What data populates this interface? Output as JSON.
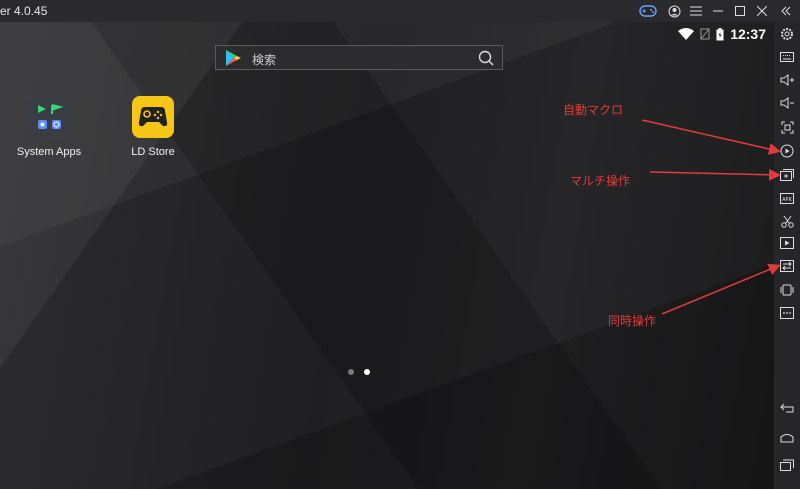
{
  "window": {
    "title": "er 4.0.45"
  },
  "status_bar": {
    "time": "12:37"
  },
  "search": {
    "placeholder": "検索"
  },
  "apps": [
    {
      "label": "System Apps"
    },
    {
      "label": "LD Store"
    }
  ],
  "annotations": {
    "macro": "自動マクロ",
    "multi": "マルチ操作",
    "sync": "同時操作"
  },
  "colors": {
    "accent_arrow": "#e23a3a",
    "ld_store_icon": "#f5c518"
  },
  "icons": {
    "titlebar": [
      "gamepad-icon",
      "account-icon",
      "menu-icon",
      "minimize-icon",
      "maximize-icon",
      "close-icon",
      "collapse-icon"
    ],
    "sidebar": [
      "settings-icon",
      "keyboard-icon",
      "volume-up-icon",
      "volume-down-icon",
      "screenshot-icon",
      "macro-icon",
      "multi-instance-icon",
      "apk-icon",
      "scissors-icon",
      "video-icon",
      "sync-icon",
      "shake-icon",
      "more-icon",
      "back-icon",
      "home-icon",
      "recents-icon"
    ]
  }
}
